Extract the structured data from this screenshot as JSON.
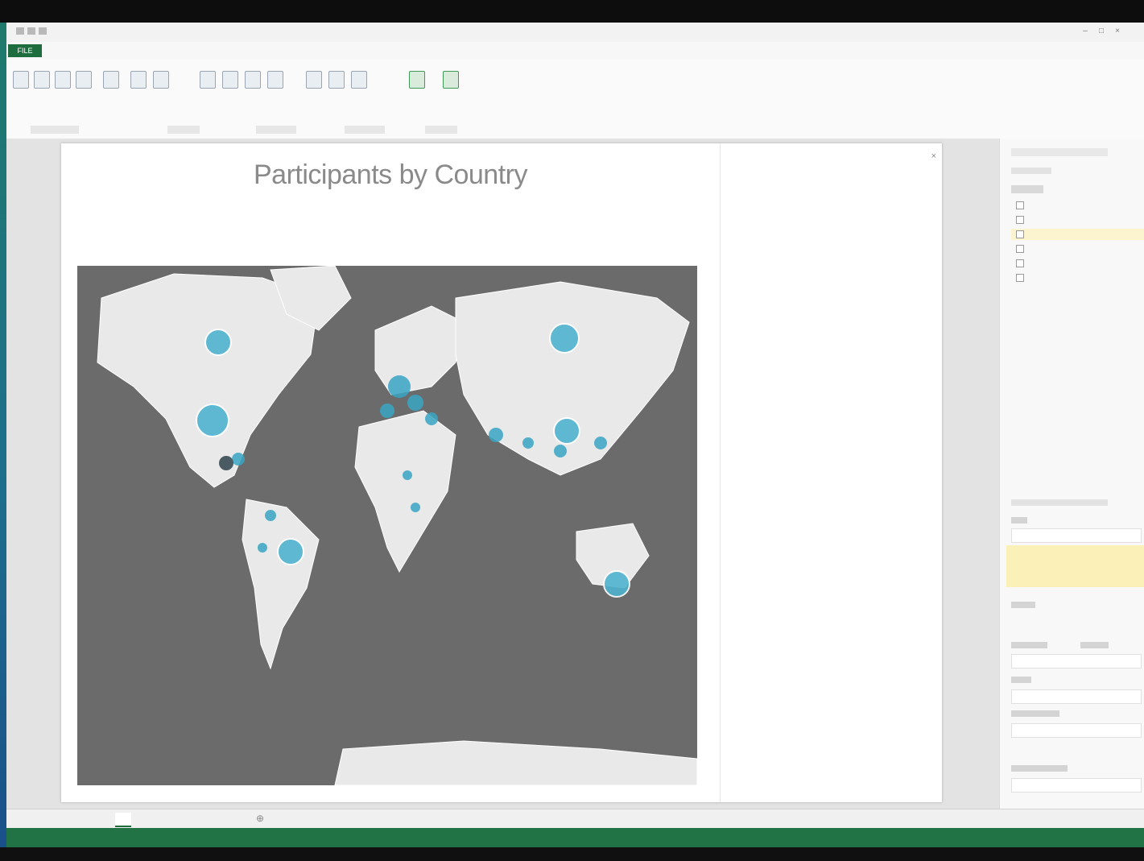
{
  "window": {
    "title": "",
    "user": ""
  },
  "menu": {
    "file_label": "FILE",
    "tabs": [
      "",
      "",
      "",
      "",
      "",
      "",
      "",
      "",
      "",
      "",
      "",
      "",
      "",
      "",
      "",
      ""
    ]
  },
  "report": {
    "title": "Participants by Country",
    "map_caption": ""
  },
  "map": {
    "ocean_labels": {
      "pacific": "",
      "atlantic": "",
      "indian": ""
    },
    "bubbles": [
      {
        "region": "North America"
      },
      {
        "region": "North America"
      },
      {
        "region": "South America"
      },
      {
        "region": "Europe"
      },
      {
        "region": "Russia"
      },
      {
        "region": "China"
      },
      {
        "region": "Australia"
      }
    ],
    "colors": {
      "ocean": "#6b6b6b",
      "land": "#eaeaea",
      "bubble": "#3aa5c4"
    }
  },
  "filters": {
    "title": "",
    "tabs": "",
    "message": ""
  },
  "field_list": {
    "title": "",
    "fields": [
      "",
      "",
      "",
      "",
      "",
      ""
    ]
  },
  "sheet_tabs": [
    "",
    "",
    ""
  ],
  "status": {
    "ready": "",
    "right": ""
  },
  "colors": {
    "accent": "#217346"
  }
}
